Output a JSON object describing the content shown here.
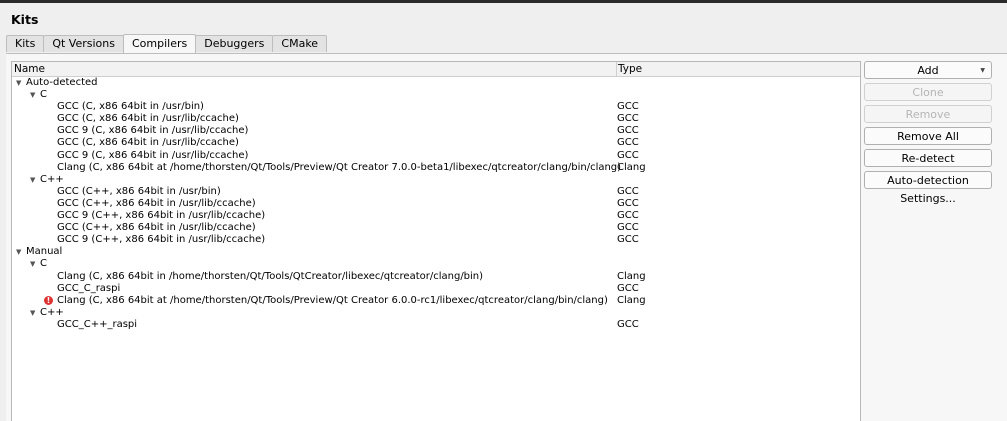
{
  "page_title": "Kits",
  "tabs": [
    {
      "label": "Kits",
      "active": false
    },
    {
      "label": "Qt Versions",
      "active": false
    },
    {
      "label": "Compilers",
      "active": true
    },
    {
      "label": "Debuggers",
      "active": false
    },
    {
      "label": "CMake",
      "active": false
    }
  ],
  "tree": {
    "headers": {
      "name": "Name",
      "type": "Type"
    },
    "rows": [
      {
        "name": "Auto-detected",
        "type": "",
        "level": 0,
        "expander": true
      },
      {
        "name": "C",
        "type": "",
        "level": 1,
        "expander": true
      },
      {
        "name": "GCC (C, x86 64bit in /usr/bin)",
        "type": "GCC",
        "level": 2
      },
      {
        "name": "GCC (C, x86 64bit in /usr/lib/ccache)",
        "type": "GCC",
        "level": 2
      },
      {
        "name": "GCC 9 (C, x86 64bit in /usr/lib/ccache)",
        "type": "GCC",
        "level": 2
      },
      {
        "name": "GCC (C, x86 64bit in /usr/lib/ccache)",
        "type": "GCC",
        "level": 2
      },
      {
        "name": "GCC 9 (C, x86 64bit in /usr/lib/ccache)",
        "type": "GCC",
        "level": 2
      },
      {
        "name": "Clang (C, x86 64bit at /home/thorsten/Qt/Tools/Preview/Qt Creator 7.0.0-beta1/libexec/qtcreator/clang/bin/clang)",
        "type": "Clang",
        "level": 2
      },
      {
        "name": "C++",
        "type": "",
        "level": 1,
        "expander": true
      },
      {
        "name": "GCC (C++, x86 64bit in /usr/bin)",
        "type": "GCC",
        "level": 2
      },
      {
        "name": "GCC (C++, x86 64bit in /usr/lib/ccache)",
        "type": "GCC",
        "level": 2
      },
      {
        "name": "GCC 9 (C++, x86 64bit in /usr/lib/ccache)",
        "type": "GCC",
        "level": 2
      },
      {
        "name": "GCC (C++, x86 64bit in /usr/lib/ccache)",
        "type": "GCC",
        "level": 2
      },
      {
        "name": "GCC 9 (C++, x86 64bit in /usr/lib/ccache)",
        "type": "GCC",
        "level": 2
      },
      {
        "name": "Manual",
        "type": "",
        "level": 0,
        "expander": true
      },
      {
        "name": "C",
        "type": "",
        "level": 1,
        "expander": true
      },
      {
        "name": "Clang (C, x86 64bit in /home/thorsten/Qt/Tools/QtCreator/libexec/qtcreator/clang/bin)",
        "type": "Clang",
        "level": 2
      },
      {
        "name": "GCC_C_raspi",
        "type": "GCC",
        "level": 2
      },
      {
        "name": "Clang (C, x86 64bit at /home/thorsten/Qt/Tools/Preview/Qt Creator 6.0.0-rc1/libexec/qtcreator/clang/bin/clang)",
        "type": "Clang",
        "level": 2,
        "error": true
      },
      {
        "name": "C++",
        "type": "",
        "level": 1,
        "expander": true
      },
      {
        "name": "GCC_C++_raspi",
        "type": "GCC",
        "level": 2
      }
    ]
  },
  "buttons": {
    "add": "Add",
    "clone": "Clone",
    "remove": "Remove",
    "remove_all": "Remove All",
    "redetect": "Re-detect",
    "auto_settings": "Auto-detection Settings..."
  },
  "icons": {
    "expander": "triangle-down-icon",
    "error": "error-icon",
    "dropdown": "dropdown-arrow-icon"
  },
  "colors": {
    "error": "#d33333",
    "disabled_text": "#b5b5b5"
  }
}
